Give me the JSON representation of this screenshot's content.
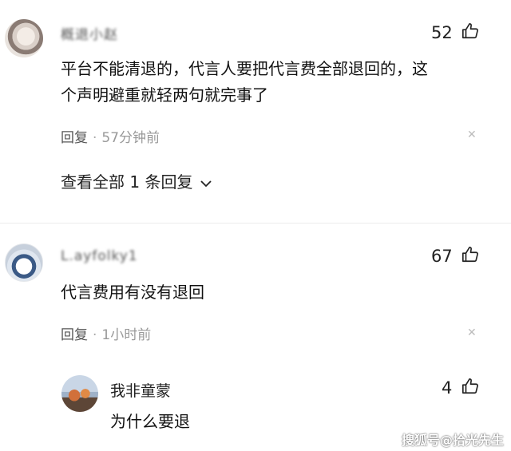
{
  "comments": [
    {
      "username": "概退小赵",
      "likes": "52",
      "text_line1": "平台不能清退的，代言人要把代言费全部退回的，这",
      "text_line2": "个声明避重就轻两句就完事了",
      "reply_label": "回复",
      "time": "57分钟前",
      "view_all_label": "查看全部 1 条回复"
    },
    {
      "username": "L.ayfolky1",
      "likes": "67",
      "text": "代言费用有没有退回",
      "reply_label": "回复",
      "time": "1小时前",
      "reply": {
        "username": "我非童蒙",
        "likes": "4",
        "text": "为什么要退"
      }
    }
  ],
  "separator": "·",
  "watermark": "搜狐号@拾光先生",
  "icons": [
    "thumbs-up-icon",
    "close-icon",
    "chevron-down-icon"
  ]
}
